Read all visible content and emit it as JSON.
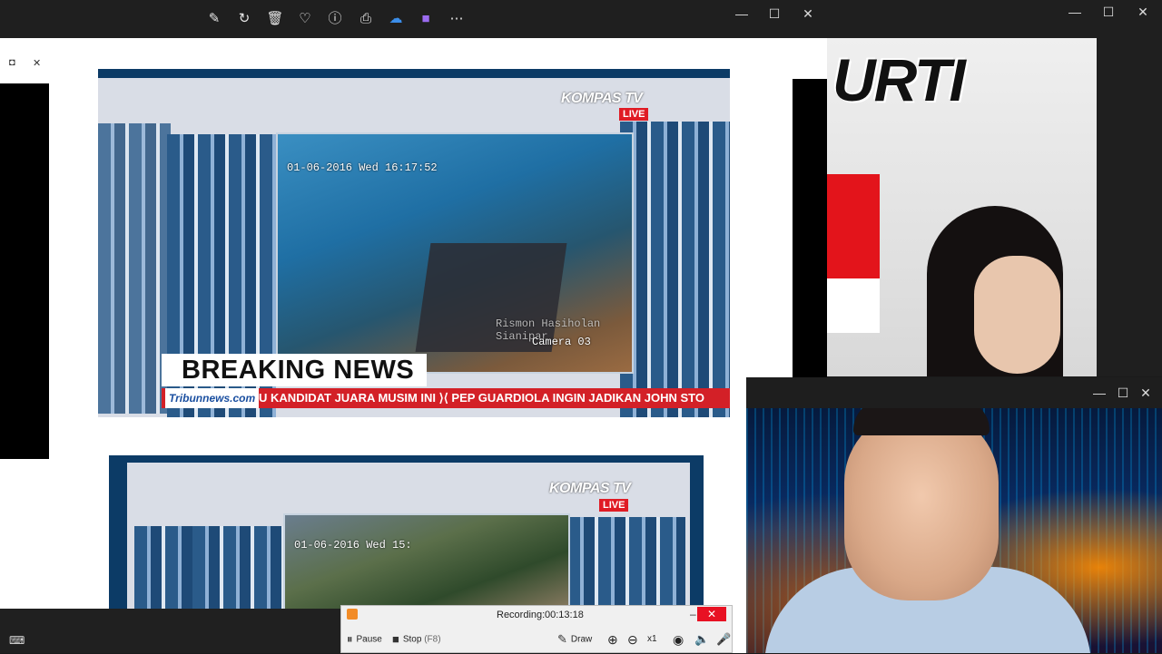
{
  "viewer": {
    "toolbar_icons": [
      "edit-icon",
      "rotate-icon",
      "delete-icon",
      "favorite-icon",
      "info-icon",
      "print-icon",
      "onedrive-icon",
      "clipchamp-icon",
      "more-icon"
    ],
    "window_controls": {
      "minimize": "—",
      "maximize": "☐",
      "close": "✕"
    },
    "sub_controls": {
      "restore": "◘",
      "close": "✕"
    }
  },
  "frame1": {
    "timestamp": "01-06-2016 Wed 16:17:52",
    "watermark": "Rismon Hasiholan Sianipar",
    "camera": "Camera 03",
    "logo": "KOMPAS TV",
    "live": "LIVE",
    "breaking": "BREAKING NEWS",
    "ticker_logo": "Tribunnews.com",
    "ticker_text": "SATU KANDIDAT JUARA MUSIM INI  ⟩⟨  PEP GUARDIOLA INGIN JADIKAN JOHN STO"
  },
  "frame2": {
    "timestamp": "01-06-2016 Wed 15:",
    "logo": "KOMPAS TV",
    "live": "LIVE"
  },
  "rightwin": {
    "headline": "URTI",
    "window_controls": {
      "minimize": "—",
      "maximize": "☐",
      "close": "✕"
    }
  },
  "webcam": {
    "window_controls": {
      "minimize": "—",
      "maximize": "☐",
      "close": "✕"
    }
  },
  "recorder": {
    "status_label": "Recording:",
    "elapsed": "00:13:18",
    "minimize": "–",
    "close": "✕",
    "pause_label": "Pause",
    "stop_label": "Stop",
    "stop_shortcut": "(F8)",
    "draw_label": "Draw",
    "zoom_level": "x1"
  },
  "colors": {
    "accent_red": "#d32027",
    "live_red": "#e01b24",
    "recorder_close": "#e81123"
  }
}
